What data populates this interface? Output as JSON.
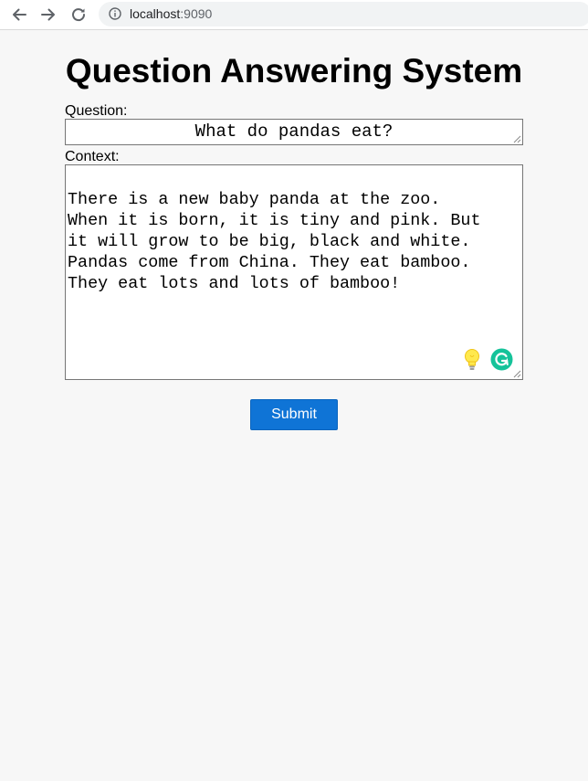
{
  "browser": {
    "url_host": "localhost",
    "url_port": ":9090"
  },
  "page": {
    "title": "Question Answering System",
    "question_label": "Question:",
    "question_value": "What do pandas eat?",
    "context_label": "Context:",
    "context_value": "There is a new baby panda at the zoo.\nWhen it is born, it is tiny and pink. But\nit will grow to be big, black and white.\nPandas come from China. They eat bamboo.\nThey eat lots and lots of bamboo!",
    "submit_label": "Submit"
  },
  "icons": {
    "back": "arrow-left",
    "forward": "arrow-right",
    "reload": "reload",
    "info": "info-circle",
    "bulb": "lightbulb",
    "grammarly": "grammarly-g"
  },
  "colors": {
    "page_background": "#f7f7f7",
    "submit_background": "#0f74d6",
    "grammarly_green": "#15c39a",
    "bulb_yellow": "#ffe94d"
  }
}
